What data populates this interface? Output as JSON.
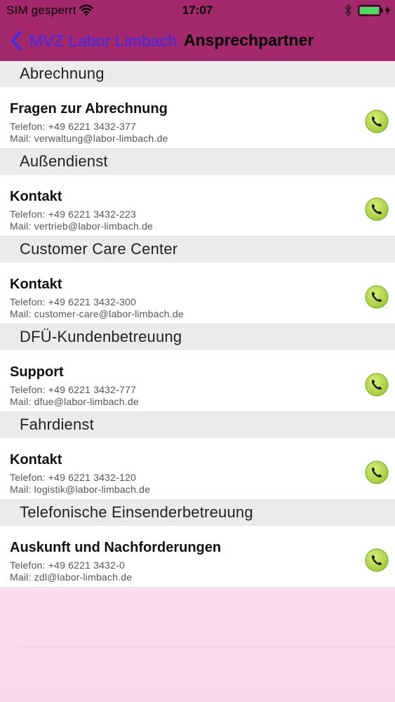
{
  "status_bar": {
    "carrier": "SIM gesperrt",
    "time": "17:07",
    "icons": [
      "wifi-icon",
      "bluetooth-icon",
      "battery-icon"
    ]
  },
  "nav": {
    "back_label": "MVZ Labor Limbach",
    "title": "Ansprechpartner"
  },
  "colors": {
    "header": "#a4296c",
    "back_link": "#3b2cf5",
    "section_bg": "#ebebeb",
    "call_button": "#b5d94a"
  },
  "sections": [
    {
      "title": "Abrechnung",
      "contact": {
        "title": "Fragen zur Abrechnung",
        "phone": "Telefon: +49 6221 3432-377",
        "mail": "Mail: verwaltung@labor-limbach.de"
      }
    },
    {
      "title": "Außendienst",
      "contact": {
        "title": "Kontakt",
        "phone": "Telefon: +49 6221 3432-223",
        "mail": "Mail: vertrieb@labor-limbach.de"
      }
    },
    {
      "title": "Customer Care Center",
      "contact": {
        "title": "Kontakt",
        "phone": "Telefon: +49 6221 3432-300",
        "mail": "Mail: customer-care@labor-limbach.de"
      }
    },
    {
      "title": "DFÜ-Kundenbetreuung",
      "contact": {
        "title": "Support",
        "phone": "Telefon: +49 6221 3432-777",
        "mail": "Mail: dfue@labor-limbach.de"
      }
    },
    {
      "title": "Fahrdienst",
      "contact": {
        "title": "Kontakt",
        "phone": "Telefon: +49 6221 3432-120",
        "mail": "Mail: logistik@labor-limbach.de"
      }
    },
    {
      "title": "Telefonische Einsenderbetreuung",
      "contact": {
        "title": "Auskunft und Nachforderungen",
        "phone": "Telefon: +49 6221 3432-0",
        "mail": "Mail: zdl@labor-limbach.de"
      }
    }
  ]
}
